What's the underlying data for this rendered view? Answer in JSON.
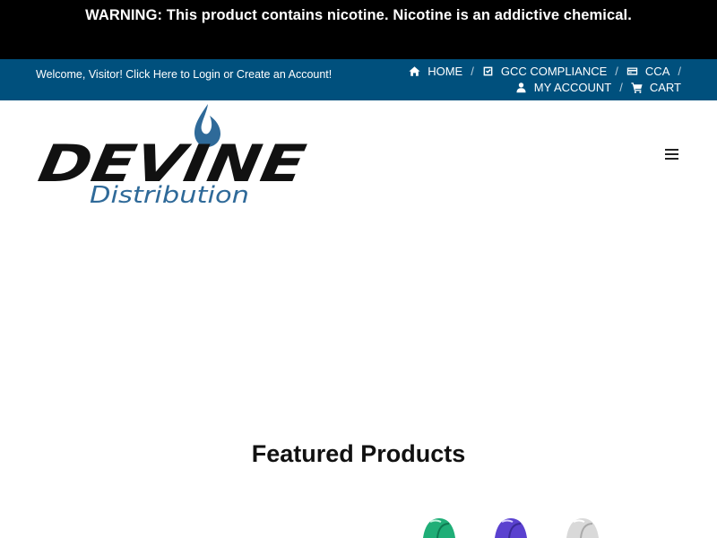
{
  "warning": {
    "text": "WARNING: This product contains nicotine. Nicotine is an addictive chemical."
  },
  "topbar": {
    "welcome": "Welcome, Visitor! Click Here to Login or Create an Account!",
    "nav": {
      "home": "HOME",
      "gcc": "GCC COMPLIANCE",
      "cca": "CCA",
      "account": "MY ACCOUNT",
      "cart": "CART"
    },
    "separator": "/",
    "icons": [
      "home-icon",
      "checkbox-icon",
      "card-icon",
      "user-icon",
      "cart-icon"
    ]
  },
  "brand": {
    "name": "DEVINE",
    "tagline": "Distribution",
    "colors": {
      "primary": "#00507d",
      "logo_blue": "#2f6a99",
      "logo_black": "#111111"
    }
  },
  "header": {
    "menu_icon": "hamburger-menu-icon"
  },
  "featured": {
    "title": "Featured Products"
  },
  "colors": {
    "warning_bg": "#000000",
    "topbar_bg": "#00507d"
  }
}
